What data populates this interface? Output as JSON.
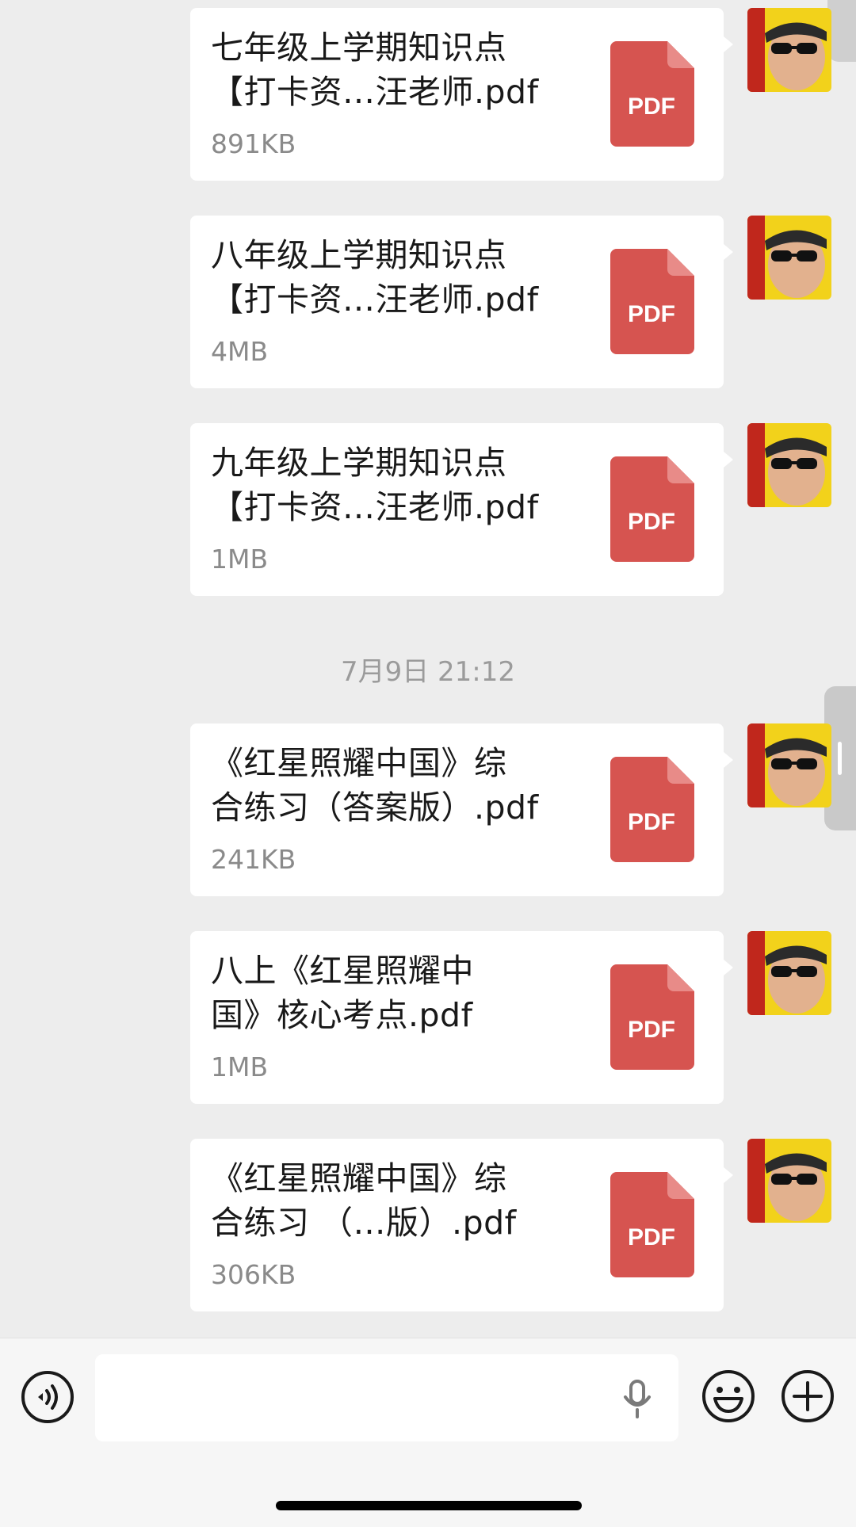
{
  "messages": [
    {
      "name": "七年级上学期知识点\n【打卡资…汪老师.pdf",
      "size": "891KB",
      "icon_label": "PDF"
    },
    {
      "name": "八年级上学期知识点\n【打卡资…汪老师.pdf",
      "size": "4MB",
      "icon_label": "PDF"
    },
    {
      "name": "九年级上学期知识点\n【打卡资…汪老师.pdf",
      "size": "1MB",
      "icon_label": "PDF"
    },
    {
      "name": "《红星照耀中国》综\n合练习（答案版）.pdf",
      "size": "241KB",
      "icon_label": "PDF"
    },
    {
      "name": "八上《红星照耀中\n国》核心考点.pdf",
      "size": "1MB",
      "icon_label": "PDF"
    },
    {
      "name": "《红星照耀中国》综\n合练习 （…版）.pdf",
      "size": "306KB",
      "icon_label": "PDF"
    }
  ],
  "timestamp": "7月9日 21:12",
  "icons": {
    "file": "pdf-file-icon",
    "voice": "voice-mode-icon",
    "mic": "microphone-icon",
    "emoji": "emoji-icon",
    "plus": "plus-icon"
  },
  "colors": {
    "background": "#ededed",
    "bubble": "#ffffff",
    "pdf_red": "#d65450",
    "pdf_fold": "#e88b88"
  }
}
